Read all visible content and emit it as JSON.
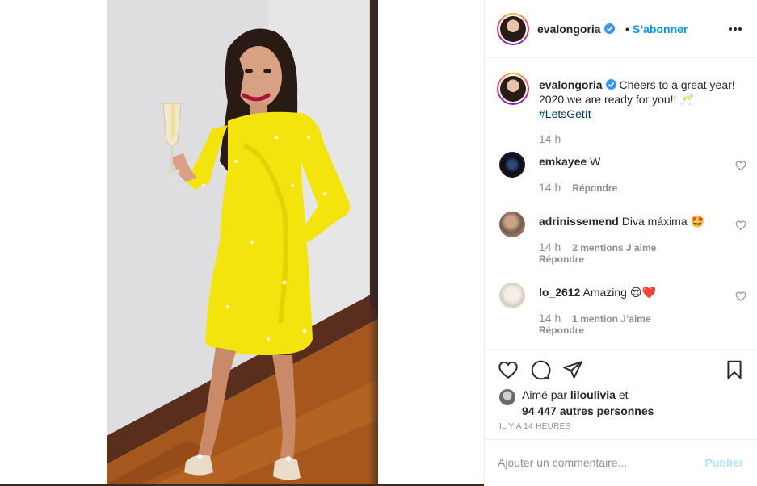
{
  "post": {
    "author": "evalongoria",
    "follow_label": "S’abonner",
    "follow_separator": "•",
    "more_icon": "more-horizontal-icon"
  },
  "caption": {
    "username": "evalongoria",
    "text": "Cheers to a great year! 2020 we are ready for you!! 🥂",
    "hashtag": "#LetsGetIt",
    "time": "14 h"
  },
  "comments": [
    {
      "username": "emkayee",
      "text": "W",
      "time": "14 h",
      "likes": "",
      "reply": "Répondre"
    },
    {
      "username": "adrinissemend",
      "text": "Diva máxima 🤩",
      "time": "14 h",
      "likes": "2 mentions J’aime",
      "reply": "Répondre"
    },
    {
      "username": "lo_2612",
      "text": "Amazing 😍❤️",
      "time": "14 h",
      "likes": "1 mention J’aime",
      "reply": "Répondre"
    }
  ],
  "likes": {
    "prefix": "Aimé par",
    "user": "liloulivia",
    "conjunction": "et",
    "others": "94 447 autres personnes"
  },
  "timestamp": "IL Y A 14 HEURES",
  "add_comment": {
    "placeholder": "Ajouter un commentaire...",
    "publish": "Publier"
  },
  "colors": {
    "accent": "#0095f6",
    "publish_disabled": "#b2dffc",
    "dress": "#f2e40c",
    "hashtag": "#00376b",
    "muted": "#8e8e8e",
    "text": "#262626"
  }
}
